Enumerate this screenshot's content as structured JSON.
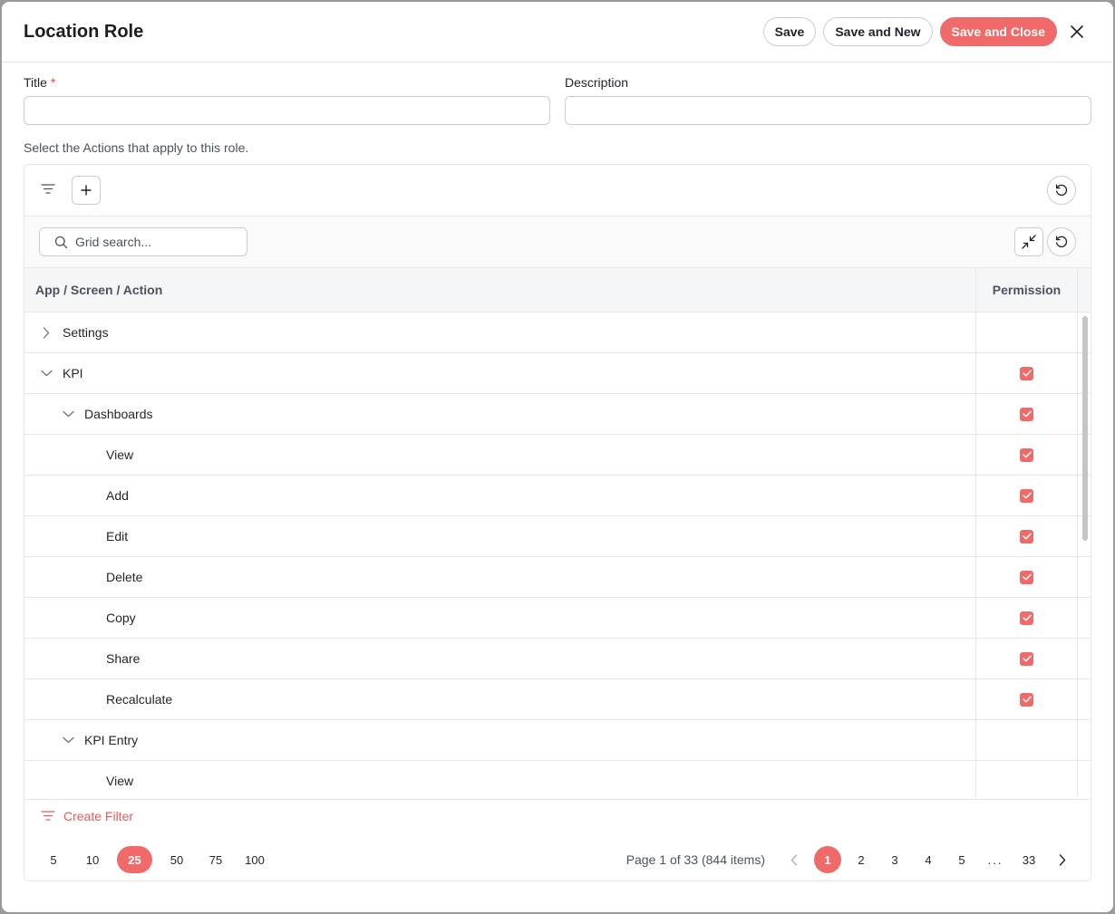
{
  "header": {
    "title": "Location Role",
    "save_label": "Save",
    "save_new_label": "Save and New",
    "save_close_label": "Save and Close"
  },
  "form": {
    "title_label": "Title",
    "title_required_mark": "*",
    "title_value": "",
    "description_label": "Description",
    "description_value": "",
    "hint": "Select the Actions that apply to this role."
  },
  "grid": {
    "search_placeholder": "Grid search...",
    "columns": [
      "App / Screen / Action",
      "Permission"
    ],
    "rows": [
      {
        "label": "Settings",
        "level": 0,
        "expander": "collapsed",
        "checked": false
      },
      {
        "label": "KPI",
        "level": 0,
        "expander": "expanded",
        "checked": true
      },
      {
        "label": "Dashboards",
        "level": 1,
        "expander": "expanded",
        "checked": true
      },
      {
        "label": "View",
        "level": 2,
        "expander": "none",
        "checked": true
      },
      {
        "label": "Add",
        "level": 2,
        "expander": "none",
        "checked": true
      },
      {
        "label": "Edit",
        "level": 2,
        "expander": "none",
        "checked": true
      },
      {
        "label": "Delete",
        "level": 2,
        "expander": "none",
        "checked": true
      },
      {
        "label": "Copy",
        "level": 2,
        "expander": "none",
        "checked": true
      },
      {
        "label": "Share",
        "level": 2,
        "expander": "none",
        "checked": true
      },
      {
        "label": "Recalculate",
        "level": 2,
        "expander": "none",
        "checked": true
      },
      {
        "label": "KPI Entry",
        "level": 1,
        "expander": "expanded",
        "checked": false
      },
      {
        "label": "View",
        "level": 2,
        "expander": "none",
        "checked": false
      }
    ],
    "create_filter_label": "Create Filter",
    "page_sizes": [
      "5",
      "10",
      "25",
      "50",
      "75",
      "100"
    ],
    "active_page_size": "25",
    "page_info": "Page 1 of 33 (844 items)",
    "pages": [
      "1",
      "2",
      "3",
      "4",
      "5"
    ],
    "ellipsis": "...",
    "last_page": "33",
    "active_page": "1"
  },
  "colors": {
    "accent": "#f06a6a"
  }
}
